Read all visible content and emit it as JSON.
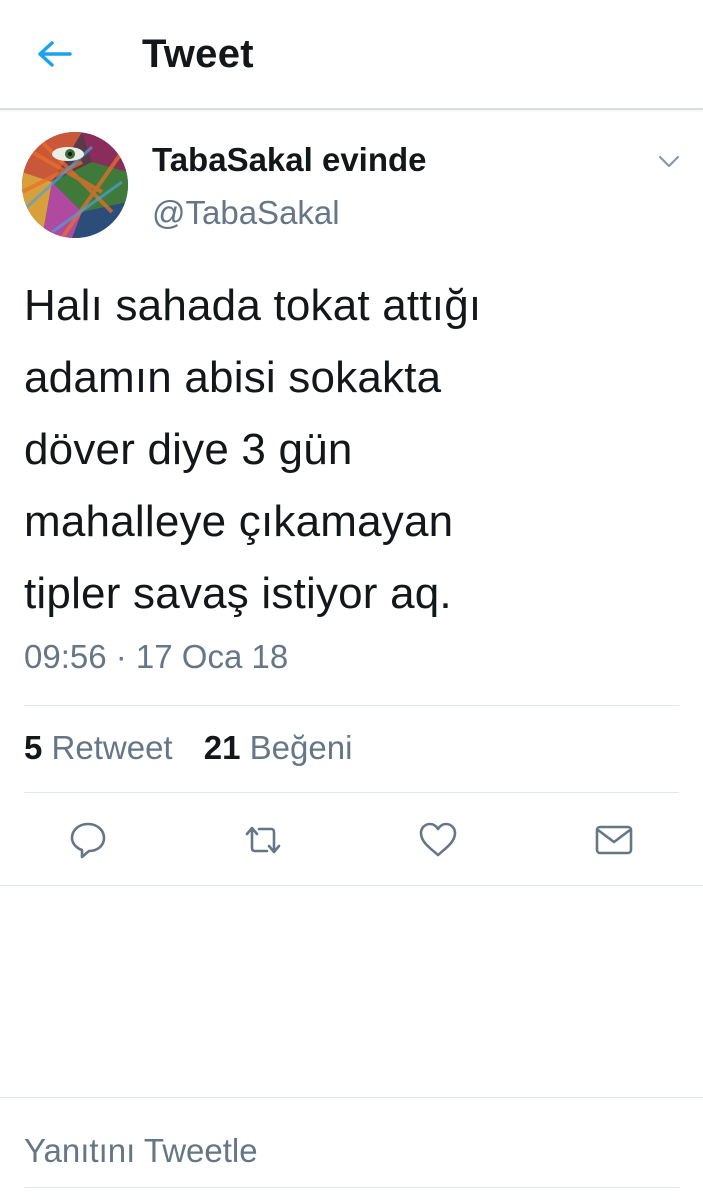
{
  "header": {
    "back_icon": "arrow-left-icon",
    "title": "Tweet"
  },
  "tweet": {
    "author": {
      "display_name": "TabaSakal evinde",
      "handle": "@TabaSakal",
      "avatar": "profile-picture"
    },
    "menu_icon": "chevron-down-icon",
    "text_lines": [
      "Halı sahada tokat attığı",
      "adamın abisi sokakta",
      "döver diye 3 gün",
      "mahalleye çıkamayan",
      "tipler savaş istiyor aq."
    ],
    "timestamp": "09:56 · 17 Oca 18",
    "stats": {
      "retweets": {
        "count": "5",
        "label": "Retweet"
      },
      "likes": {
        "count": "21",
        "label": "Beğeni"
      }
    },
    "actions": [
      {
        "name": "reply",
        "icon": "speech-bubble-icon"
      },
      {
        "name": "retweet",
        "icon": "retweet-icon"
      },
      {
        "name": "like",
        "icon": "heart-icon"
      },
      {
        "name": "direct-message",
        "icon": "envelope-icon"
      }
    ]
  },
  "reply_box": {
    "placeholder": "Yanıtını Tweetle"
  },
  "colors": {
    "accent": "#1da1f2",
    "text_primary": "#14171a",
    "text_secondary": "#657786",
    "divider": "#e1e8ed"
  }
}
